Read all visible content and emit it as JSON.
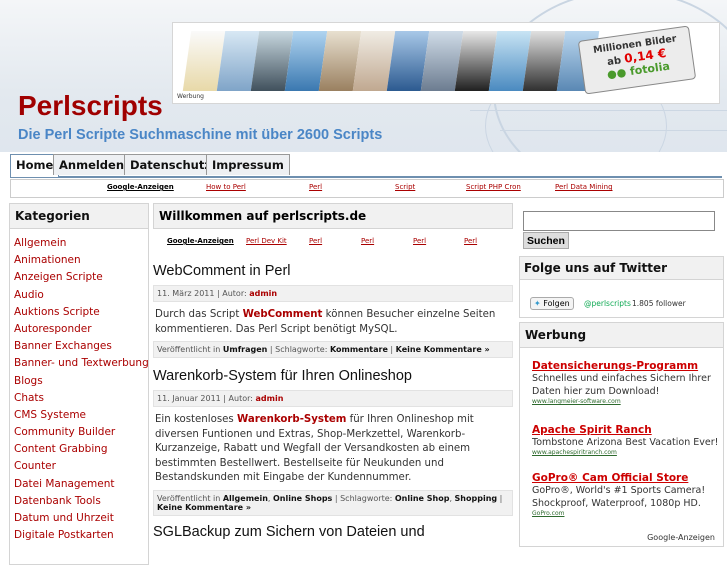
{
  "site": {
    "title": "Perlscripts",
    "tagline": "Die Perl Scripte Suchmaschine mit über 2600 Scripts"
  },
  "ad_banner": {
    "label": "Werbung",
    "line1": "Millionen Bilder",
    "line2_prefix": "ab",
    "price": "0,14 €",
    "brand": "fotolia"
  },
  "nav": {
    "tabs": [
      "Home",
      "Anmelden",
      "Datenschutz",
      "Impressum"
    ]
  },
  "link_bar": {
    "google": "Google-Anzeigen",
    "links": [
      "How to Perl",
      "Perl",
      "Script",
      "Script PHP Cron",
      "Perl Data Mining"
    ]
  },
  "sidebar_left": {
    "heading": "Kategorien",
    "categories": [
      "Allgemein",
      "Animationen",
      "Anzeigen Scripte",
      "Audio",
      "Auktions Scripte",
      "Autoresponder",
      "Banner Exchanges",
      "Banner- und Textwerbung",
      "Blogs",
      "Chats",
      "CMS Systeme",
      "Community Builder",
      "Content Grabbing",
      "Counter",
      "Datei Management",
      "Datenbank Tools",
      "Datum und Uhrzeit",
      "Digitale Postkarten"
    ]
  },
  "main": {
    "heading": "Willkommen auf perlscripts.de",
    "links": {
      "google": "Google-Anzeigen",
      "items": [
        "Perl Dev Kit",
        "Perl",
        "Perl",
        "Perl",
        "Perl"
      ]
    },
    "posts": [
      {
        "title": "WebComment in Perl",
        "date": "11. März 2011",
        "author_label": "Autor:",
        "author": "admin",
        "text_before": "Durch das Script ",
        "highlight": "WebComment",
        "text_after": " können Besucher einzelne Seiten kommentieren. Das Perl Script benötigt MySQL.",
        "published_label": "Veröffentlicht in",
        "category": "Umfragen",
        "tags_label": "Schlagworte:",
        "tags": "Kommentare",
        "comments": "Keine Kommentare »"
      },
      {
        "title": "Warenkorb-System für Ihren Onlineshop",
        "date": "11. Januar 2011",
        "author_label": "Autor:",
        "author": "admin",
        "text_before": "Ein kostenloses ",
        "highlight": "Warenkorb-System",
        "text_after": " für Ihren Onlineshop mit diversen Funtionen und Extras, Shop-Merkzettel, Warenkorb-Kurzanzeige, Rabatt und Wegfall der Versandkosten ab einem bestimmten Bestellwert. Bestellseite für Neukunden und Bestandskunden mit Eingabe der Kundennummer.",
        "published_label": "Veröffentlicht in",
        "category": "Allgemein",
        "category2": "Online Shops",
        "tags_label": "Schlagworte:",
        "tags": "Online Shop",
        "tags2": "Shopping",
        "comments": "Keine Kommentare »"
      },
      {
        "title": "SGLBackup zum Sichern von Dateien und"
      }
    ]
  },
  "sidebar_right": {
    "search_button": "Suchen",
    "twitter_heading": "Folge uns auf Twitter",
    "follow_button": "Folgen",
    "follow_name": "@perlscripts",
    "follow_count": "1.805 follower",
    "ads_heading": "Werbung",
    "ads": [
      {
        "title": "Datensicherungs-Programm",
        "desc": "Schnelles und einfaches Sichern Ihrer Daten hier zum Download!",
        "url": "www.langmeier-software.com"
      },
      {
        "title": "Apache Spirit Ranch",
        "desc": "Tombstone Arizona Best Vacation Ever!",
        "url": "www.apachespiritranch.com"
      },
      {
        "title": "GoPro® Cam Official Store",
        "desc": "GoPro®, World's #1 Sports Camera! Shockproof, Waterproof, 1080p HD.",
        "url": "GoPro.com"
      }
    ],
    "google_badge": "Google-Anzeigen"
  },
  "colors": {
    "title_red": "#a00000",
    "tagline_blue": "#4a86c6",
    "link_red": "#aa0000",
    "nav_border": "#6e8faf"
  }
}
